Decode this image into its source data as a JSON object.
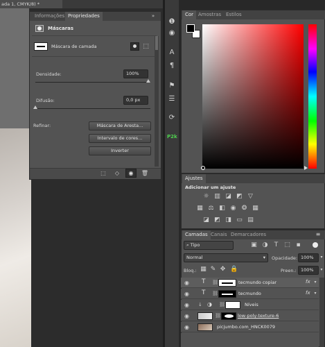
{
  "document": {
    "tab_title": "ada 1, CMYK/8) *"
  },
  "properties": {
    "tabs": [
      {
        "label": "Informações"
      },
      {
        "label": "Propriedades"
      }
    ],
    "header": "Máscaras",
    "layer_mask_label": "Máscara de camada",
    "density_label": "Densidade:",
    "density_value": "100%",
    "density_level": 1.0,
    "feather_label": "Difusão:",
    "feather_value": "0,0 px",
    "feather_level": 0.0,
    "refine_label": "Refinar:",
    "buttons": [
      "Máscara de Aresta...",
      "Intervalo de cores...",
      "Inverter"
    ]
  },
  "toolstrip": {
    "icons": [
      "info-icon",
      "brush-settings-icon",
      "character-icon",
      "paragraph-icon",
      "clone-source-icon",
      "adjustments-icon",
      "history-icon",
      "adobe-icon"
    ]
  },
  "color_panel": {
    "tabs": [
      {
        "label": "Cor"
      },
      {
        "label": "Amostras"
      },
      {
        "label": "Estilos"
      }
    ],
    "foreground": "#000000",
    "background": "#ffffff",
    "hue": "#ff0000"
  },
  "adjustments": {
    "tab": "Ajustes",
    "heading": "Adicionar um ajuste",
    "row1": [
      "brightness-icon",
      "levels-icon",
      "curves-icon",
      "exposure-icon",
      "vibrance-icon"
    ],
    "row2": [
      "hue-sat-icon",
      "color-balance-icon",
      "black-white-icon",
      "photo-filter-icon",
      "channel-mixer-icon",
      "color-lookup-icon"
    ],
    "row3": [
      "invert-icon",
      "posterize-icon",
      "threshold-icon",
      "selective-color-icon",
      "gradient-map-icon"
    ]
  },
  "layers_panel": {
    "tabs": [
      {
        "label": "Camadas"
      },
      {
        "label": "Canais"
      },
      {
        "label": "Demarcadores"
      }
    ],
    "filter_kind": "Tipo",
    "blend_mode": "Normal",
    "opacity_label": "Opacidade:",
    "opacity_value": "100%",
    "lock_label": "Bloq.:",
    "fill_label": "Preen.:",
    "fill_value": "100%",
    "layers": [
      {
        "name": "tecmundo copiar",
        "fx": "fx"
      },
      {
        "name": "tecmundo",
        "fx": "fx"
      },
      {
        "name": "Níveis",
        "fx": ""
      },
      {
        "name": "low-poly-texture-6",
        "fx": ""
      },
      {
        "name": "picjumbo.com_HNCK0079",
        "fx": ""
      }
    ]
  }
}
